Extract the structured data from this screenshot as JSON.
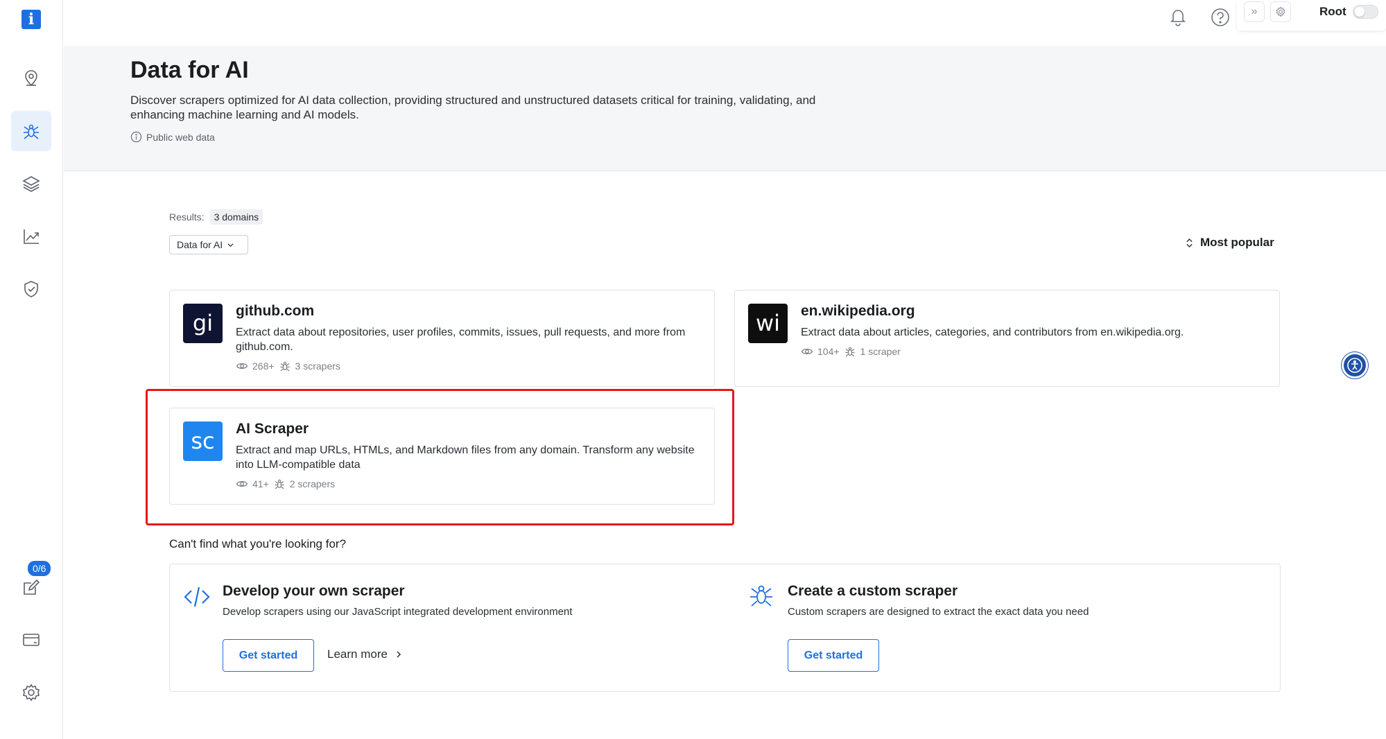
{
  "sidebar": {
    "logo_letter": "i",
    "items": [
      {
        "name": "location-icon"
      },
      {
        "name": "spider-icon",
        "active": true
      },
      {
        "name": "layers-icon"
      },
      {
        "name": "chart-icon"
      },
      {
        "name": "shield-check-icon"
      }
    ],
    "tasks_badge": "0/6",
    "bottom_items": [
      {
        "name": "edit-icon"
      },
      {
        "name": "billing-card-icon"
      },
      {
        "name": "settings-icon"
      }
    ]
  },
  "topbar": {
    "root_label": "Root",
    "expand_glyph": "»"
  },
  "header": {
    "title": "Data for AI",
    "description": "Discover scrapers optimized for AI data collection, providing structured and unstructured datasets critical for training, validating, and enhancing machine learning and AI models.",
    "public_note": "Public web data"
  },
  "results": {
    "label": "Results:",
    "count": "3 domains",
    "filter_value": "Data for AI",
    "sort_label": "Most popular"
  },
  "cards": [
    {
      "logo_text": "gi",
      "logo_color": "#0f1433",
      "title": "github.com",
      "description": "Extract data about repositories, user profiles, commits, issues, pull requests, and more from github.com.",
      "views": "268+",
      "scrapers": "3 scrapers"
    },
    {
      "logo_text": "wi",
      "logo_color": "#0e0e0e",
      "title": "en.wikipedia.org",
      "description": "Extract data about articles, categories, and contributors from en.wikipedia.org.",
      "views": "104+",
      "scrapers": "1 scraper"
    },
    {
      "logo_text": "sc",
      "logo_color": "#1f86f0",
      "title": "AI Scraper",
      "description": "Extract and map URLs, HTMLs, and Markdown files from any domain. Transform any website into LLM-compatible data",
      "views": "41+",
      "scrapers": "2 scrapers"
    }
  ],
  "cant_find": {
    "heading": "Can't find what you're looking for?",
    "develop": {
      "title": "Develop your own scraper",
      "description": "Develop scrapers using our JavaScript integrated development environment",
      "cta": "Get started",
      "learn_more": "Learn more"
    },
    "custom": {
      "title": "Create a custom scraper",
      "description": "Custom scrapers are designed to extract the exact data you need",
      "cta": "Get started"
    }
  },
  "colors": {
    "accent": "#1f6fe0",
    "highlight": "#e8151b"
  }
}
